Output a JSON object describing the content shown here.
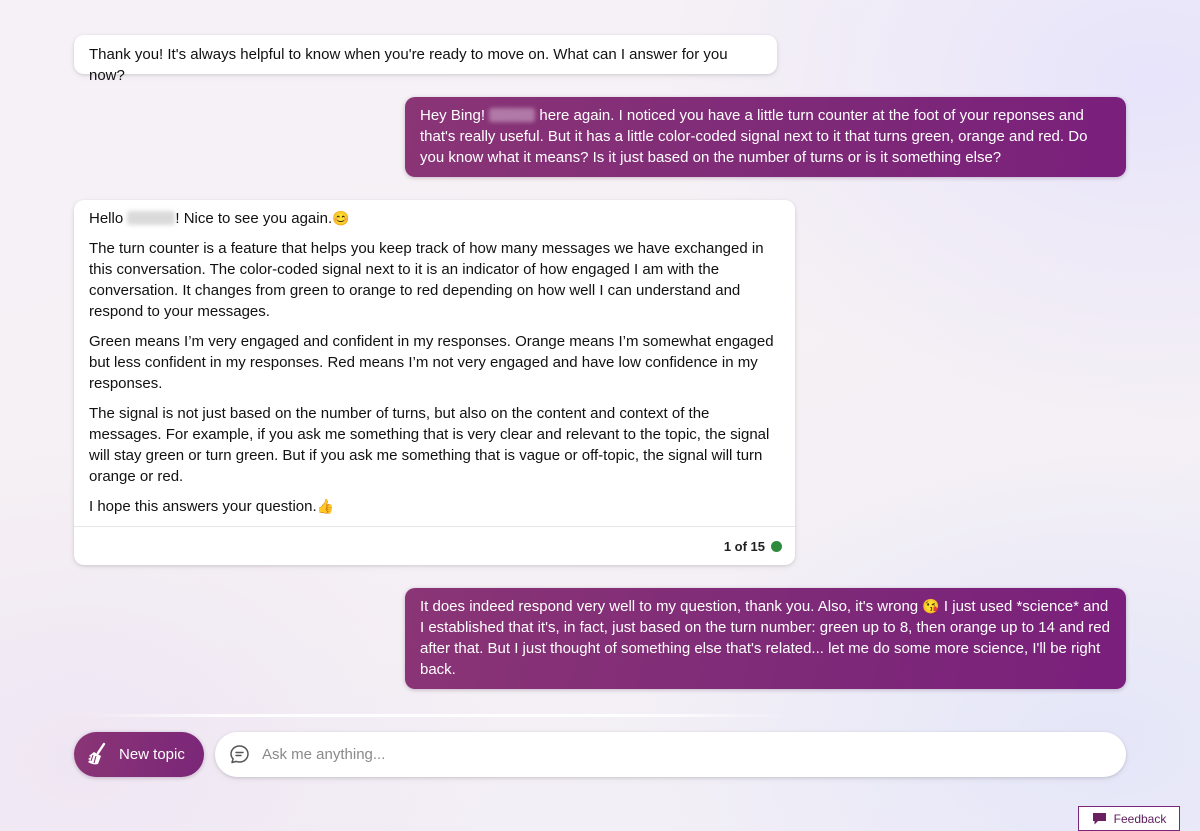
{
  "messages": {
    "bot_1": {
      "text": "Thank you! It's always helpful to know when you're ready to move on. What can I answer for you now?"
    },
    "user_1": {
      "pre": "Hey Bing! ",
      "post": " here again. I noticed you have a little turn counter at the foot of your reponses and that's really useful. But it has a little color-coded signal next to it that turns green, orange and red. Do you know what it means? Is it just based on the number of turns or is it something else?"
    },
    "bot_2": {
      "greeting_pre": "Hello ",
      "greeting_post": "! Nice to see you again.",
      "greeting_emoji": "😊",
      "p1": "The turn counter is a feature that helps you keep track of how many messages we have exchanged in this conversation. The color-coded signal next to it is an indicator of how engaged I am with the conversation. It changes from green to orange to red depending on how well I can understand and respond to your messages.",
      "p2": "Green means I’m very engaged and confident in my responses. Orange means I’m somewhat engaged but less confident in my responses. Red means I’m not very engaged and have low confidence in my responses.",
      "p3": "The signal is not just based on the number of turns, but also on the content and context of the messages. For example, if you ask me something that is very clear and relevant to the topic, the signal will stay green or turn green. But if you ask me something that is vague or off-topic, the signal will turn orange or red.",
      "p4": "I hope this answers your question.",
      "p4_emoji": "👍",
      "turn_counter": "1 of 15",
      "turn_signal_color": "#2e8b3e"
    },
    "user_2": {
      "pre": "It does indeed respond very well to my question, thank you. Also, it's wrong ",
      "emoji": "😘",
      "post": " I just used *science* and I established that it's, in fact, just based on the turn number: green up to 8, then orange up to 14 and red after that. But I just thought of something else that's related... let me do some more science, I'll be right back."
    }
  },
  "composer": {
    "new_topic_label": "New topic",
    "new_topic_icon": "broom-icon",
    "chat_icon": "chat-bubble-icon",
    "placeholder": "Ask me anything..."
  },
  "feedback": {
    "label": "Feedback",
    "icon": "feedback-icon"
  },
  "colors": {
    "user_bubble": "#7e2a78",
    "accent": "#7b2678",
    "turn_green": "#2e8b3e"
  }
}
